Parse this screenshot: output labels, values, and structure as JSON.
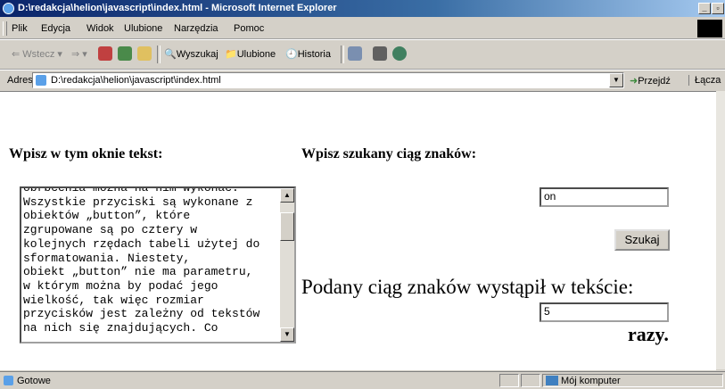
{
  "window": {
    "title": "D:\\redakcja\\helion\\javascript\\index.html - Microsoft Internet Explorer"
  },
  "menu": [
    "Plik",
    "Edycja",
    "Widok",
    "Ulubione",
    "Narzędzia",
    "Pomoc"
  ],
  "toolbar": {
    "back": "Wstecz",
    "search": "Wyszukaj",
    "favorites": "Ulubione",
    "history": "Historia"
  },
  "address": {
    "label": "Adres",
    "url": "D:\\redakcja\\helion\\javascript\\index.html",
    "go": "Przejdź",
    "links": "Łącza"
  },
  "page": {
    "left_heading": "Wpisz w tym oknie tekst:",
    "right_heading": "Wpisz szukany ciąg znaków:",
    "textarea_text": "obrbcenia można na nim wykonac.\nWszystkie przyciski są wykonane z\nobiektów „button”, które\nzgrupowane są po cztery w\nkolejnych rzędach tabeli użytej do\nsformatowania. Niestety,\nobiekt „button” nie ma parametru,\nw którym można by podać jego\nwielkość, tak więc rozmiar\nprzycisków jest zależny od tekstów\nna nich się znajdujących. Co",
    "search_value": "on",
    "search_button": "Szukaj",
    "result_label": "Podany ciąg znaków wystąpił w tekście:",
    "result_value": "5",
    "times_label": "razy."
  },
  "status": {
    "text": "Gotowe",
    "zone": "Mój komputer"
  }
}
